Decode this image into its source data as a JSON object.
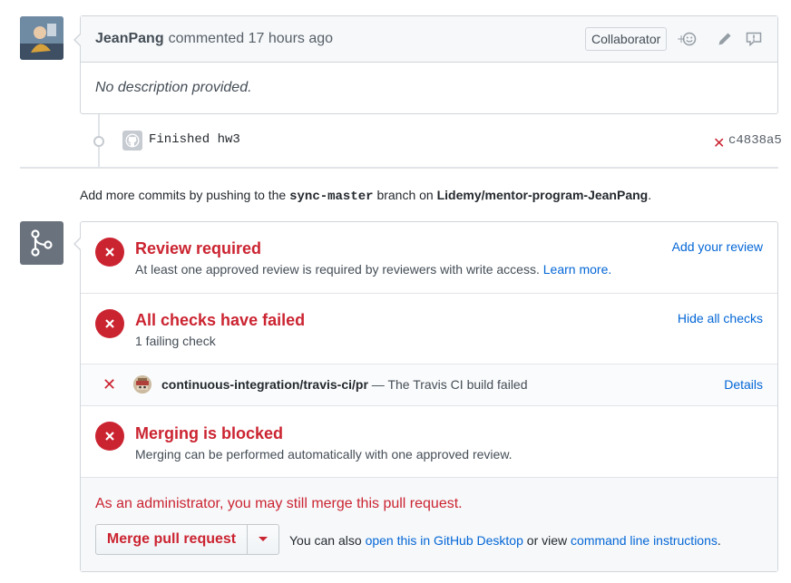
{
  "comment": {
    "author": "JeanPang",
    "meta": "commented 17 hours ago",
    "badge": "Collaborator",
    "body": "No description provided."
  },
  "commit": {
    "message": "Finished hw3",
    "sha": "c4838a5",
    "status_icon": "x-icon"
  },
  "push_note": {
    "prefix": "Add more commits by pushing to the",
    "branch": "sync-master",
    "middle": "branch on",
    "repo": "Lidemy/mentor-program-JeanPang",
    "suffix": "."
  },
  "review": {
    "title": "Review required",
    "subtitle": "At least one approved review is required by reviewers with write access.",
    "learn_more": "Learn more.",
    "action": "Add your review"
  },
  "checks": {
    "title": "All checks have failed",
    "subtitle": "1 failing check",
    "action": "Hide all checks",
    "items": [
      {
        "name": "continuous-integration/travis-ci/pr",
        "separator": "—",
        "description": "The Travis CI build failed",
        "details": "Details"
      }
    ]
  },
  "blocked": {
    "title": "Merging is blocked",
    "subtitle": "Merging can be performed automatically with one approved review."
  },
  "admin": {
    "note": "As an administrator, you may still merge this pull request.",
    "merge_button": "Merge pull request",
    "also_prefix": "You can also",
    "desktop_link": "open this in GitHub Desktop",
    "or_view": "or view",
    "cli_link": "command line instructions",
    "period": "."
  },
  "colors": {
    "error": "#cb2431",
    "link": "#0366d6",
    "border": "#d1d5da"
  }
}
